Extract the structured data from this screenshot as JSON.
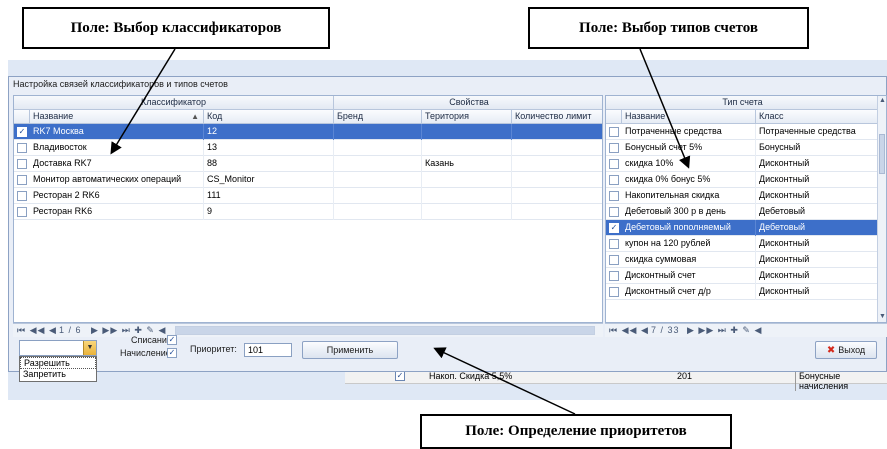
{
  "callouts": {
    "classifiers": "Поле: Выбор классификаторов",
    "account_types": "Поле: Выбор типов счетов",
    "priorities": "Поле: Определение приоритетов"
  },
  "dialog": {
    "title": "Настройка связей классификаторов и типов счетов"
  },
  "left_grid": {
    "bands": {
      "classifier": "Классификатор",
      "properties": "Свойства"
    },
    "columns": {
      "name": "Название",
      "code": "Код",
      "brand": "Бренд",
      "territory": "Територия",
      "limit": "Количество лимит"
    },
    "rows": [
      {
        "checked": true,
        "name": "RK7 Москва",
        "code": "12",
        "brand": "",
        "territory": "",
        "limit": ""
      },
      {
        "checked": false,
        "name": "Владивосток",
        "code": "13",
        "brand": "",
        "territory": "",
        "limit": ""
      },
      {
        "checked": false,
        "name": "Доставка RK7",
        "code": "88",
        "brand": "",
        "territory": "Казань",
        "limit": ""
      },
      {
        "checked": false,
        "name": "Монитор автоматических операций",
        "code": "CS_Monitor",
        "brand": "",
        "territory": "",
        "limit": ""
      },
      {
        "checked": false,
        "name": "Ресторан 2 RK6",
        "code": "111",
        "brand": "",
        "territory": "",
        "limit": ""
      },
      {
        "checked": false,
        "name": "Ресторан RK6",
        "code": "9",
        "brand": "",
        "territory": "",
        "limit": ""
      }
    ],
    "nav": {
      "position": "1 / 6"
    }
  },
  "right_grid": {
    "band": "Тип счета",
    "columns": {
      "name": "Название",
      "class": "Класс"
    },
    "rows": [
      {
        "checked": false,
        "name": "Потраченные средства",
        "class": "Потраченные средства"
      },
      {
        "checked": false,
        "name": "Бонусный счет 5%",
        "class": "Бонусный"
      },
      {
        "checked": false,
        "name": "скидка 10%",
        "class": "Дисконтный"
      },
      {
        "checked": false,
        "name": "скидка 0% бонус 5%",
        "class": "Дисконтный"
      },
      {
        "checked": false,
        "name": "Накопительная скидка",
        "class": "Дисконтный"
      },
      {
        "checked": false,
        "name": "Дебетовый 300 р в день",
        "class": "Дебетовый"
      },
      {
        "checked": true,
        "name": "Дебетовый пополняемый",
        "class": "Дебетовый"
      },
      {
        "checked": false,
        "name": "купон на 120 рублей",
        "class": "Дисконтный"
      },
      {
        "checked": false,
        "name": "скидка суммовая",
        "class": "Дисконтный"
      },
      {
        "checked": false,
        "name": "Дисконтный счет",
        "class": "Дисконтный"
      },
      {
        "checked": false,
        "name": "Дисконтный счет д/р",
        "class": "Дисконтный"
      }
    ],
    "nav": {
      "position": "7 / 33"
    }
  },
  "controls": {
    "dropdown_options": [
      "Разрешить",
      "Запретить"
    ],
    "write_off_label": "Списание",
    "write_off_checked": true,
    "accrual_label": "Начисление",
    "accrual_checked": true,
    "priority_label": "Приоритет:",
    "priority_value": "101",
    "apply_label": "Применить",
    "exit_label": "Выход"
  },
  "backdrop": {
    "row_name": "Накоп. Скидка 5,5%",
    "row_value": "201",
    "row_type": "Бонусные начисления"
  },
  "colors": {
    "selection": "#3d6fc9",
    "dialog_bg": "#e9eef7",
    "exit_icon": "#d42a1c"
  }
}
